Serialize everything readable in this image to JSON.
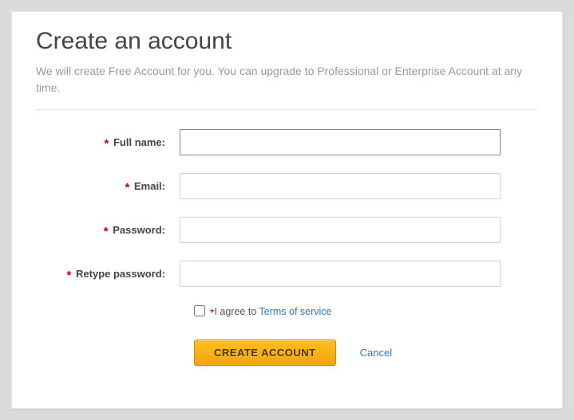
{
  "title": "Create an account",
  "subtitle": "We will create Free Account for you. You can upgrade to Professional or Enterprise Account at any time.",
  "fields": {
    "fullname": {
      "label": "Full name:",
      "value": ""
    },
    "email": {
      "label": "Email:",
      "value": ""
    },
    "password": {
      "label": "Password:",
      "value": ""
    },
    "retype": {
      "label": "Retype password:",
      "value": ""
    }
  },
  "agree": {
    "prefix": "I agree to ",
    "link": "Terms of service"
  },
  "buttons": {
    "create": "CREATE ACCOUNT",
    "cancel": "Cancel"
  }
}
